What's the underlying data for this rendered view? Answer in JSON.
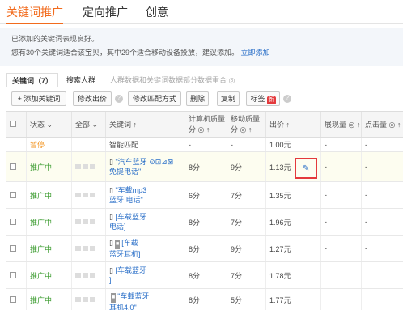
{
  "top_tabs": [
    "关键词推广",
    "定向推广",
    "创意"
  ],
  "notice": {
    "line1": "已添加的关键词表现良好。",
    "line2": "您有30个关键词适合该宝贝，其中29个适合移动设备投放，建议添加。",
    "link": "立即添加"
  },
  "sub_tabs": [
    "关键词（7）",
    "搜索人群",
    "人群数据和关键词数据部分数据重合 ◎"
  ],
  "toolbar": {
    "add": "+ 添加关键词",
    "modify_bid": "修改出价",
    "modify_match": "修改匹配方式",
    "delete": "删除",
    "copy": "复制",
    "tag": "标签",
    "tag_badge": "新"
  },
  "columns": {
    "status": "状态 ⌄",
    "all": "全部 ⌄",
    "keyword": "关键词 ↑",
    "pc_quality_a": "计算机质量",
    "pc_quality_b": "分 ◎ ↑",
    "mobile_quality_a": "移动质量",
    "mobile_quality_b": "分 ◎ ↑",
    "bid": "出价 ↑",
    "impressions": "展现量 ◎ ↑",
    "clicks": "点击量 ◎ ↑"
  },
  "rows": [
    {
      "status": "暂停",
      "keyword_1": "智能匹配",
      "keyword_2": "",
      "pc": "-",
      "mobile": "-",
      "bid": "1.00元",
      "imp": "-",
      "clk": "-",
      "type": "paused"
    },
    {
      "status": "推广中",
      "keyword_1": "\"汽车蓝牙",
      "keyword_2": "免提电话\"",
      "pc": "8分",
      "mobile": "9分",
      "bid": "1.13元",
      "imp": "-",
      "clk": "-",
      "type": "active"
    },
    {
      "status": "推广中",
      "keyword_1": "\"车载mp3",
      "keyword_2": "蓝牙 电话\"",
      "pc": "6分",
      "mobile": "7分",
      "bid": "1.35元",
      "imp": "-",
      "clk": "-",
      "type": "active"
    },
    {
      "status": "推广中",
      "keyword_1": "[车载蓝牙",
      "keyword_2": "电话]",
      "pc": "8分",
      "mobile": "7分",
      "bid": "1.96元",
      "imp": "-",
      "clk": "-",
      "type": "active"
    },
    {
      "status": "推广中",
      "keyword_1": "[车载",
      "keyword_2": "蓝牙耳机]",
      "pc": "8分",
      "mobile": "9分",
      "bid": "1.27元",
      "imp": "-",
      "clk": "-",
      "type": "active"
    },
    {
      "status": "推广中",
      "keyword_1": "[车载蓝牙",
      "keyword_2": "]",
      "pc": "8分",
      "mobile": "7分",
      "bid": "1.78元",
      "imp": "",
      "clk": "",
      "type": "active"
    },
    {
      "status": "推广中",
      "keyword_1": "\"车载蓝牙",
      "keyword_2": "耳机4.0\"",
      "pc": "8分",
      "mobile": "5分",
      "bid": "1.77元",
      "imp": "",
      "clk": "",
      "type": "active"
    }
  ],
  "icons": {
    "phone": "mobile-phone-icon",
    "pencil": "pencil-icon",
    "help": "help-icon"
  }
}
